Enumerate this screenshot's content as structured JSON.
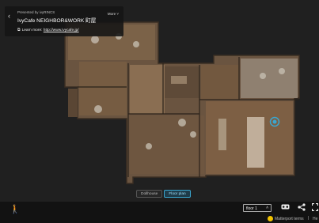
{
  "top_card": {
    "back_glyph": "‹",
    "presented_by": "Presented by ivyRINCS",
    "title": "IvyCafe NEIGHBOR&WORK 町屋",
    "more_label": "More ˅",
    "learn_more_label": "Learn more:",
    "learn_more_url": "http://www.ivycafe.jp/"
  },
  "view_toggle": {
    "dollhouse_label": "Dollhouse",
    "floorplan_label": "Floor plan",
    "active": "floorplan"
  },
  "bottom_bar": {
    "walk_icon": "person-walking-icon",
    "floor_select_value": "floor 1",
    "vr_icon": "vr-headset-icon",
    "share_icon": "share-icon",
    "fullscreen_icon": "fullscreen-icon"
  },
  "footer": {
    "terms_label": "Matterport terms",
    "separator": "|",
    "help_label": "He"
  },
  "colors": {
    "accent": "#3aa6d0",
    "matterport_yellow": "#f2c300"
  }
}
